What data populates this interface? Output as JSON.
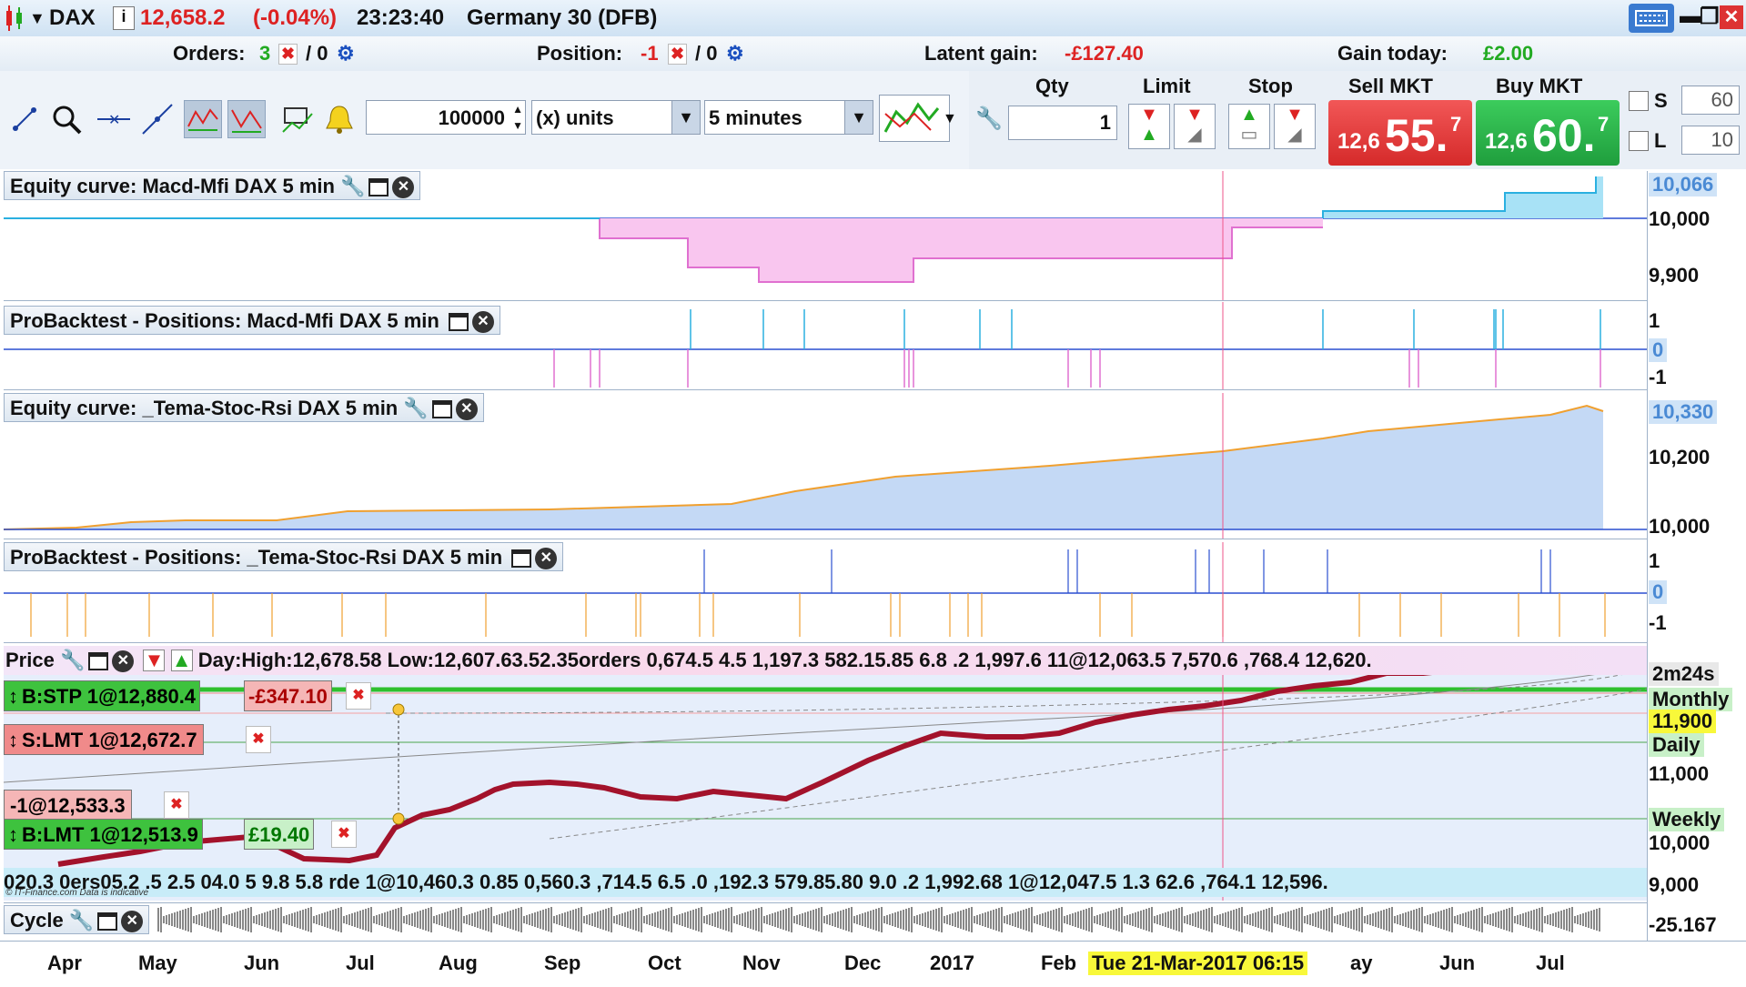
{
  "window": {
    "instrument": "DAX",
    "price": "12,658.2",
    "change": "(-0.04%)",
    "time": "23:23:40",
    "market_name": "Germany 30 (DFB)"
  },
  "order_bar": {
    "orders_label": "Orders:",
    "orders_count": "3",
    "orders_zero": "/ 0",
    "position_label": "Position:",
    "position_value": "-1",
    "position_zero": "/ 0",
    "latent_label": "Latent gain:",
    "latent_value": "-£127.40",
    "gain_today_label": "Gain today:",
    "gain_today_value": "£2.00"
  },
  "toolbar": {
    "quantity_value": "100000",
    "units_select": "(x) units",
    "interval_select": "5 minutes"
  },
  "deal": {
    "qty_header": "Qty",
    "limit_header": "Limit",
    "stop_header": "Stop",
    "sell_header": "Sell MKT",
    "buy_header": "Buy MKT",
    "qty_value": "1",
    "sell_prefix": "12,6",
    "sell_big": "55.",
    "sell_sup": "7",
    "buy_prefix": "12,6",
    "buy_big": "60.",
    "buy_sup": "7",
    "s_label": "S",
    "s_value": "60",
    "l_label": "L",
    "l_value": "10"
  },
  "panels": {
    "equity1_title": "Equity curve: Macd-Mfi DAX 5 min",
    "pos1_title": "ProBacktest - Positions: Macd-Mfi DAX 5 min",
    "equity2_title": "Equity curve: _Tema-Stoc-Rsi DAX 5 min",
    "pos2_title": "ProBacktest - Positions: _Tema-Stoc-Rsi DAX 5 min",
    "price_title": "Price",
    "cycle_title": "Cycle"
  },
  "y_labels": {
    "eq1_hl": "10,066",
    "eq1_a": "10,000",
    "eq1_b": "9,900",
    "pos1_a": "1",
    "pos1_hl": "0",
    "pos1_b": "-1",
    "eq2_hl": "10,330",
    "eq2_a": "10,200",
    "eq2_b": "10,000",
    "pos2_a": "1",
    "pos2_hl": "0",
    "pos2_b": "-1",
    "price_timer": "2m24s",
    "price_monthly": "Monthly",
    "price_hl": "11,900",
    "price_daily": "Daily",
    "price_11000": "11,000",
    "price_weekly": "Weekly",
    "price_10000": "10,000",
    "price_9000": "9,000",
    "cycle_val": "-25.167"
  },
  "price_header_text": "Day:High:12,678.58 Low:12,607.63.52.35orders 0,674.5 4.5 1,197.3 582.15.85 6.8 .2 1,997.6 11@12,063.5 7,570.6 ,768.4 12,620.",
  "ticker_text": "020.3 0ers05.2 .5 2.5 04.0 5 9.8 5.8 rde 1@10,460.3 0.85 0,560.3 ,714.5 6.5 .0 ,192.3 579.85.80 9.0 .2 1,992.68 1@12,047.5 1.3 62.6 ,764.1 12,596.",
  "copyright": "© IT-Finance.com  Data is indicative",
  "orders": {
    "stp_label": "B:STP 1@12,880.4",
    "stp_pl": "-£347.10",
    "slmt_label": "S:LMT 1@12,672.7",
    "pos_label": "-1@12,533.3",
    "blmt_label": "B:LMT 1@12,513.9",
    "blmt_pl": "£19.40"
  },
  "x_axis": [
    "Apr",
    "May",
    "Jun",
    "Jul",
    "Aug",
    "Sep",
    "Oct",
    "Nov",
    "Dec",
    "2017",
    "Feb",
    "Tue 21-Mar-2017 06:15",
    "ay",
    "Jun",
    "Jul"
  ],
  "colors": {
    "sell": "#e23b3b",
    "buy": "#26a84a",
    "equity_fill_pos": "#a8e2f6",
    "equity_fill_neg": "#f9c6ef",
    "equity2_fill": "#c4d9f5",
    "equity2_line": "#f0a030",
    "price_line": "#a3122b"
  },
  "icons": [
    "draw-icon",
    "zoom-icon",
    "hline-icon",
    "trendline-icon",
    "chart-type-icon",
    "chart-type2-icon",
    "indicator-icon",
    "alert-icon",
    "strategy-icon",
    "wrench-icon"
  ]
}
